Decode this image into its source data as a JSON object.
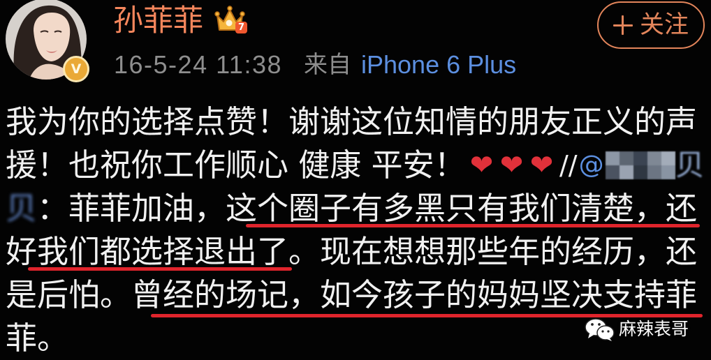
{
  "user": {
    "name": "孙菲菲",
    "verified_mark": "V",
    "vip_level": "7"
  },
  "icons": {
    "avatar": "avatar-photo",
    "verified": "verified-badge-icon",
    "vip": "vip-crown-icon",
    "follow": "plus-icon",
    "emoji": "red-heart-icon",
    "watermark": "wechat-icon"
  },
  "follow_button": {
    "label": "关注"
  },
  "meta": {
    "time": "16-5-24 11:38",
    "source_prefix": "来自",
    "source_device": "iPhone 6 Plus"
  },
  "post": {
    "line1": "我为你的选择点赞！谢谢这位知情的朋友正义的声",
    "line2": {
      "text": "援！也祝你工作顺心 健康 平安！",
      "emoji": [
        "❤",
        "❤",
        "❤"
      ],
      "repost_mark": "//",
      "mention_at": "@",
      "mention_tail": "贝"
    },
    "line3": {
      "mention_tail": "贝",
      "text": "：菲菲加油，",
      "underlined_text": "这个圈子有多黑只有我们清楚，还"
    },
    "line4": {
      "text_before": "好",
      "underlined_text": "我们都选择退出了",
      "text_after": "。现在想想那些年的经历，还"
    },
    "line5": {
      "text_before": "是后怕。",
      "underlined_text": "曾经的场记，如今孩子的妈妈坚决支持菲"
    },
    "line6": "菲。"
  },
  "watermark": {
    "text": "麻辣表哥"
  },
  "colors": {
    "background": "#030303",
    "username": "#f4865c",
    "follow_accent": "#e3855b",
    "meta_gray": "#8e8e8e",
    "link_blue": "#5c8fe0",
    "body_text": "#f1f1f1",
    "heart_red": "#e1313a",
    "annotation_red": "#e0242c",
    "verified_gold": "#eaa936",
    "watermark_text": "#ffffff"
  }
}
